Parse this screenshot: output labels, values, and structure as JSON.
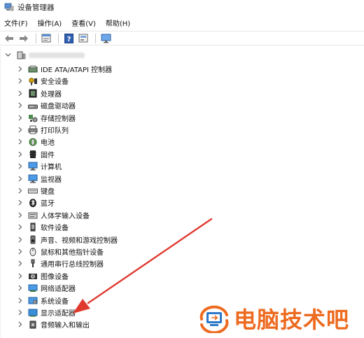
{
  "window": {
    "title": "设备管理器"
  },
  "menu": [
    {
      "label": "文件(F)"
    },
    {
      "label": "操作(A)"
    },
    {
      "label": "查看(V)"
    },
    {
      "label": "帮助(H)"
    }
  ],
  "toolbar": {
    "buttons": [
      "back-arrow-icon",
      "forward-arrow-icon",
      "properties-icon",
      "help-icon",
      "show-hidden-icon",
      "monitor-icon"
    ]
  },
  "tree": {
    "root": {
      "label": ""
    },
    "items": [
      {
        "label": "IDE ATA/ATAPI 控制器",
        "icon": "ide-controller-icon"
      },
      {
        "label": "安全设备",
        "icon": "security-key-icon"
      },
      {
        "label": "处理器",
        "icon": "processor-icon"
      },
      {
        "label": "磁盘驱动器",
        "icon": "disk-drive-icon"
      },
      {
        "label": "存储控制器",
        "icon": "storage-controller-icon"
      },
      {
        "label": "打印队列",
        "icon": "printer-icon"
      },
      {
        "label": "电池",
        "icon": "battery-icon"
      },
      {
        "label": "固件",
        "icon": "firmware-icon"
      },
      {
        "label": "计算机",
        "icon": "computer-icon"
      },
      {
        "label": "监视器",
        "icon": "monitor-icon"
      },
      {
        "label": "键盘",
        "icon": "keyboard-icon"
      },
      {
        "label": "蓝牙",
        "icon": "bluetooth-icon"
      },
      {
        "label": "人体学输入设备",
        "icon": "hid-icon"
      },
      {
        "label": "软件设备",
        "icon": "software-device-icon"
      },
      {
        "label": "声音、视频和游戏控制器",
        "icon": "speaker-icon"
      },
      {
        "label": "鼠标和其他指针设备",
        "icon": "mouse-icon"
      },
      {
        "label": "通用串行总线控制器",
        "icon": "usb-icon"
      },
      {
        "label": "图像设备",
        "icon": "camera-icon"
      },
      {
        "label": "网络适配器",
        "icon": "network-adapter-icon"
      },
      {
        "label": "系统设备",
        "icon": "system-device-icon"
      },
      {
        "label": "显示适配器",
        "icon": "display-adapter-icon"
      },
      {
        "label": "音频输入和输出",
        "icon": "audio-io-icon"
      }
    ]
  },
  "annotation": {
    "arrow_color": "#e03a2f",
    "points_to": "显示适配器"
  },
  "watermark": {
    "text": "电脑技术吧",
    "color": "#ed6a1f"
  }
}
